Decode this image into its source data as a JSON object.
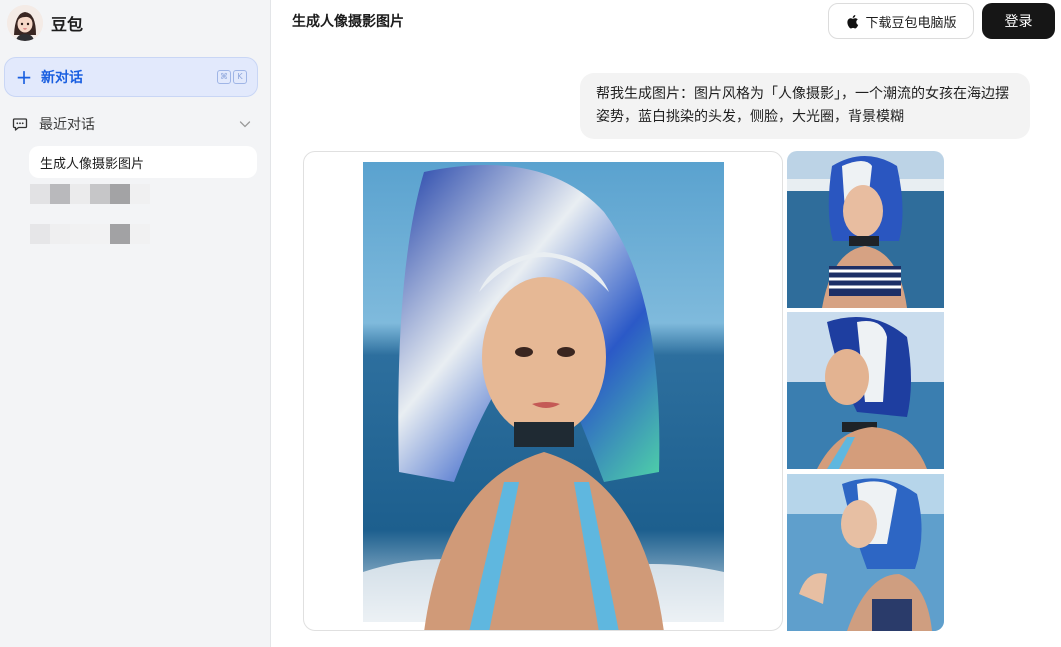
{
  "sidebar": {
    "brand_name": "豆包",
    "new_chat_label": "新对话",
    "shortcut_keys": [
      "⌘",
      "K"
    ],
    "recent_title": "最近对话",
    "conversations": [
      {
        "label": "生成人像摄影图片",
        "active": true
      }
    ]
  },
  "header": {
    "title": "生成人像摄影图片",
    "download_label": "下载豆包电脑版",
    "login_label": "登录"
  },
  "chat": {
    "user_message": "帮我生成图片：图片风格为「人像摄影」，一个潮流的女孩在海边摆姿势，蓝白挑染的头发，侧脸，大光圈，背景模糊"
  },
  "colors": {
    "accent": "#1a5fe0",
    "sidebar_bg": "#f3f4f6",
    "login_bg": "#161616"
  },
  "icons": {
    "avatar": "girl-avatar",
    "new_chat": "plus-icon",
    "recent": "chat-bubble-icon",
    "collapse": "chevron-down-icon",
    "download": "apple-icon"
  }
}
